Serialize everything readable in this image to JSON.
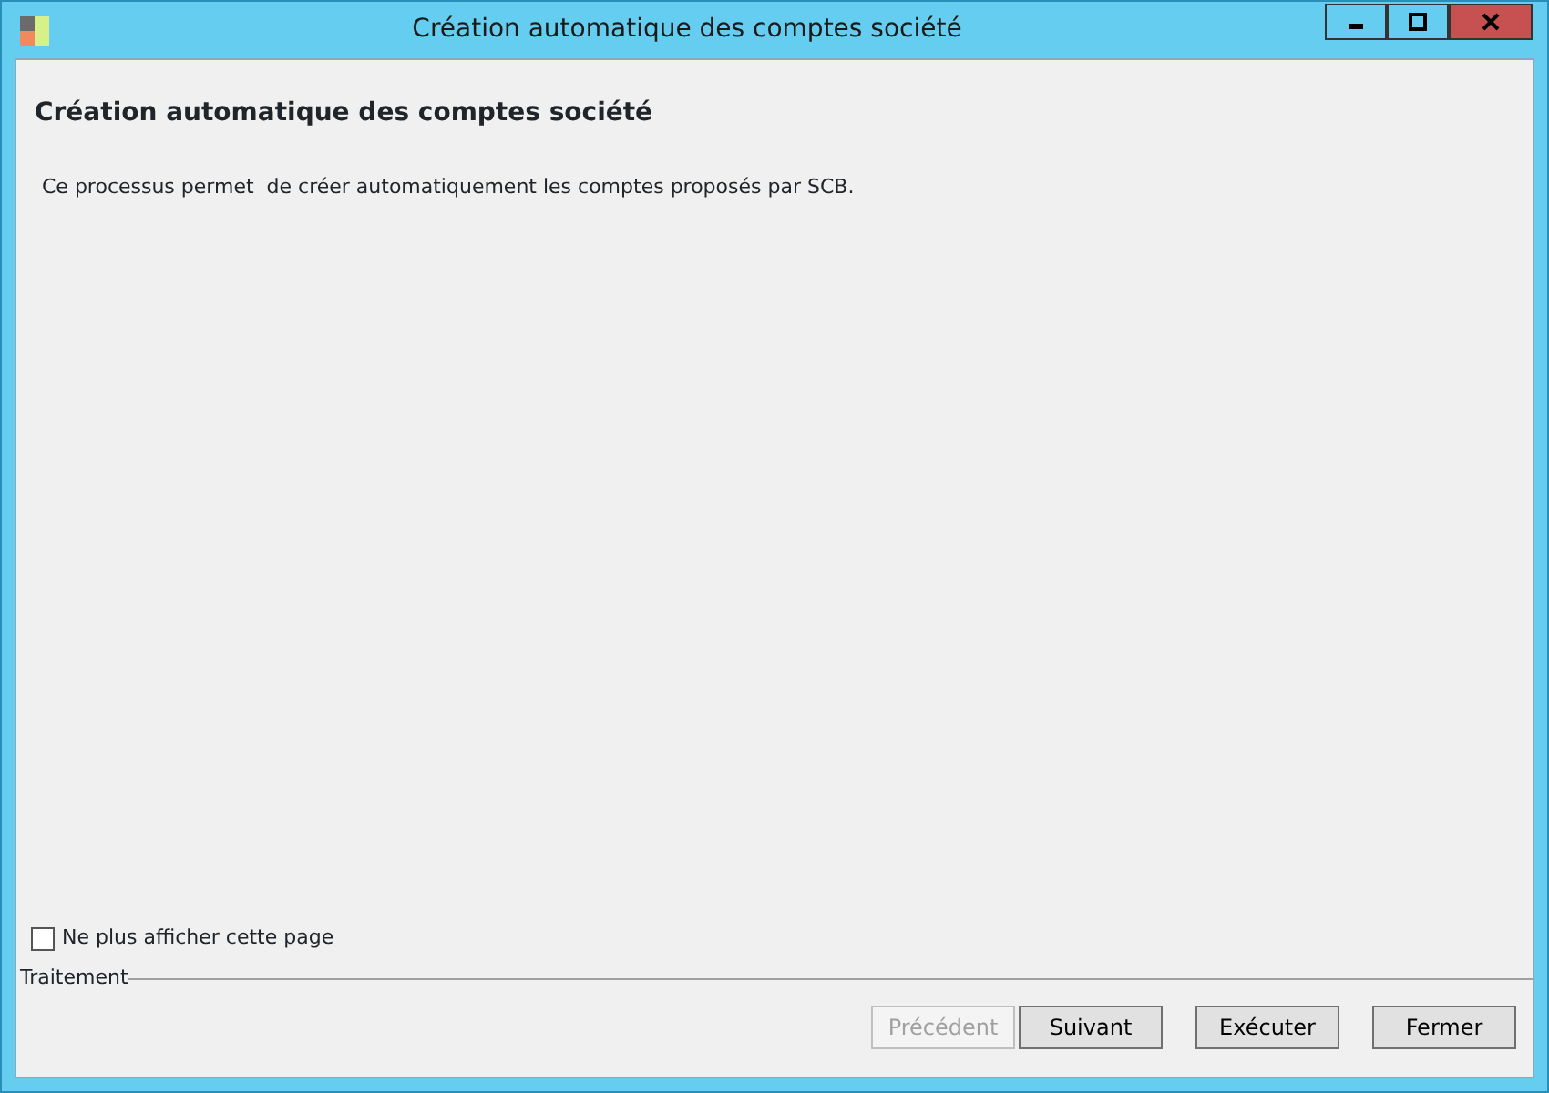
{
  "window": {
    "title": "Création automatique des comptes société"
  },
  "heading": "Création automatique des comptes société",
  "description": "Ce processus permet  de créer automatiquement les comptes proposés par SCB.",
  "dont_show_again": {
    "label": "Ne plus afficher cette page",
    "checked": false
  },
  "group_label": "Traitement",
  "nav_buttons": [
    {
      "label": "Précédent",
      "disabled": true
    },
    {
      "label": "Suivant",
      "disabled": false
    }
  ],
  "action_buttons": [
    {
      "label": "Exécuter",
      "disabled": false
    },
    {
      "label": "Fermer",
      "disabled": false
    }
  ]
}
